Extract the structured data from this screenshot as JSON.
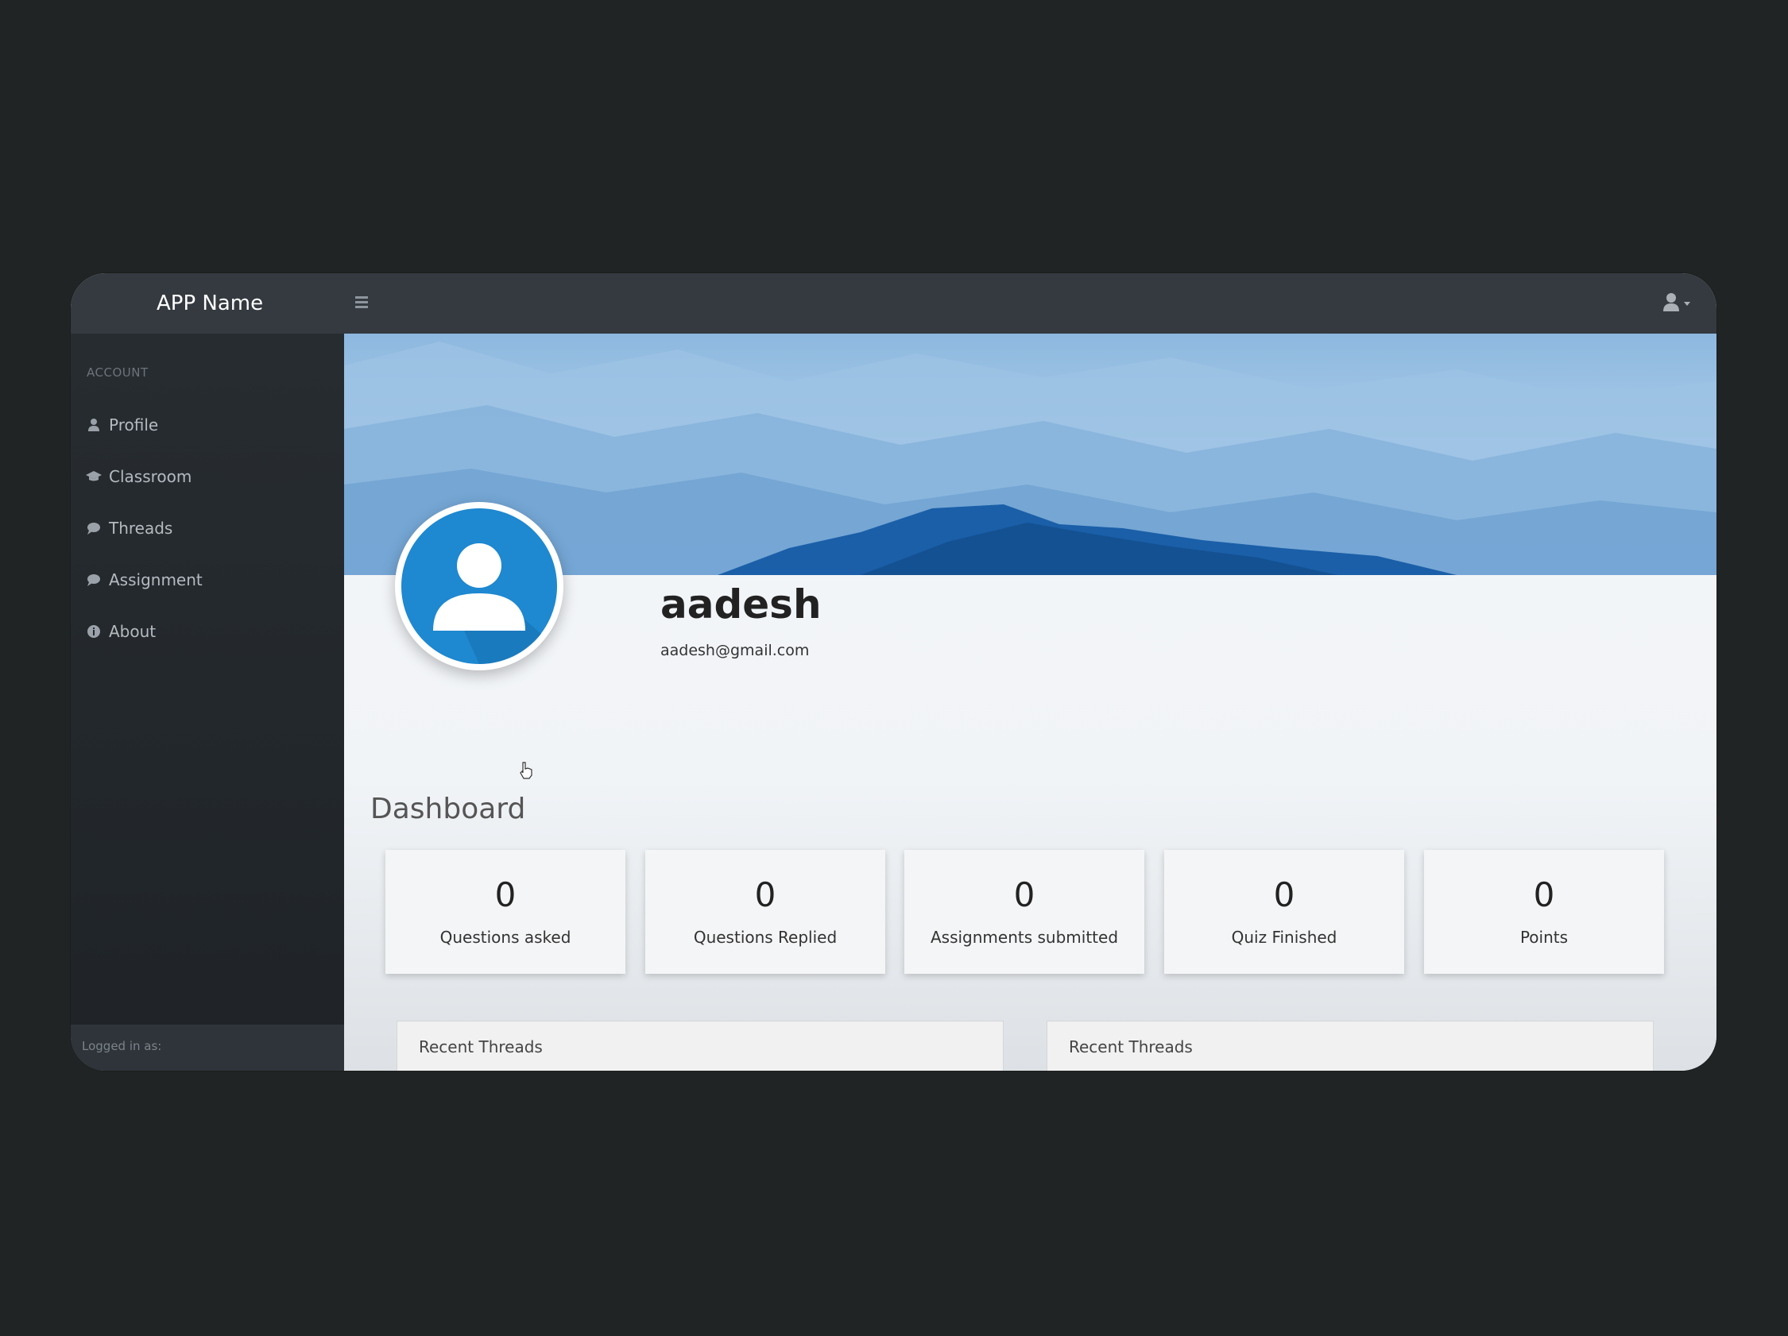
{
  "app": {
    "name": "APP Name"
  },
  "sidebar": {
    "heading": "ACCOUNT",
    "items": [
      {
        "label": "Profile",
        "icon": "user-icon"
      },
      {
        "label": "Classroom",
        "icon": "graduation-cap-icon"
      },
      {
        "label": "Threads",
        "icon": "comment-icon"
      },
      {
        "label": "Assignment",
        "icon": "comment-icon"
      },
      {
        "label": "About",
        "icon": "info-icon"
      }
    ],
    "footer": "Logged in as:"
  },
  "profile": {
    "name": "aadesh",
    "email": "aadesh@gmail.com"
  },
  "dashboard": {
    "title": "Dashboard",
    "stats": [
      {
        "value": "0",
        "label": "Questions asked"
      },
      {
        "value": "0",
        "label": "Questions Replied"
      },
      {
        "value": "0",
        "label": "Assignments submitted"
      },
      {
        "value": "0",
        "label": "Quiz Finished"
      },
      {
        "value": "0",
        "label": "Points"
      }
    ]
  },
  "panels": [
    {
      "title": "Recent Threads"
    },
    {
      "title": "Recent Threads"
    }
  ],
  "colors": {
    "topbar": "#343a40",
    "sidebar": "#22272b",
    "avatar_blue": "#1e88d0",
    "banner_dark": "#1a5fa8"
  }
}
